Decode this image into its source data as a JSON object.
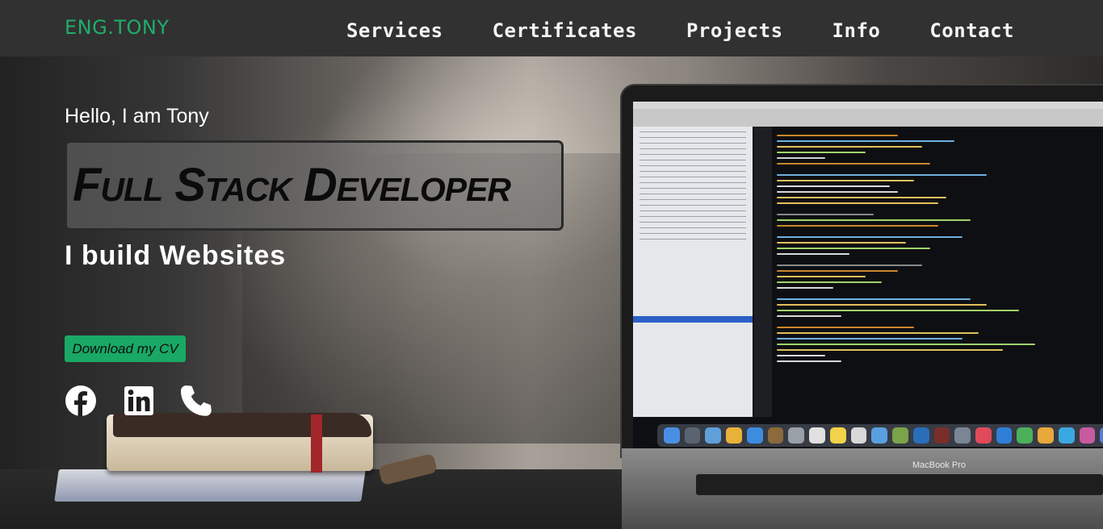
{
  "header": {
    "logo": "ENG.TONY",
    "nav": [
      {
        "label": "Services"
      },
      {
        "label": "Certificates"
      },
      {
        "label": "Projects"
      },
      {
        "label": "Info"
      },
      {
        "label": "Contact"
      }
    ]
  },
  "hero": {
    "greeting": "Hello, I am Tony",
    "title": "Full Stack Developer",
    "tagline": "I build Websites",
    "cv_button": "Download my CV",
    "social": [
      {
        "icon": "facebook-icon"
      },
      {
        "icon": "linkedin-icon"
      },
      {
        "icon": "phone-icon"
      }
    ],
    "laptop_brand": "MacBook Pro"
  },
  "colors": {
    "header_bg": "#313131",
    "logo": "#1fae6b",
    "cv_button": "#19a865",
    "nav_text": "#f4f4f4"
  }
}
